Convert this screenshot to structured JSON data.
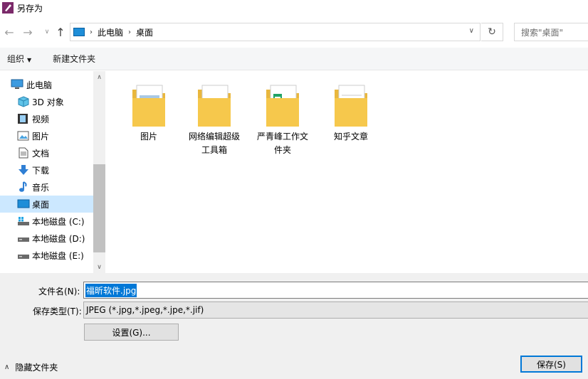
{
  "window": {
    "title": "另存为"
  },
  "nav": {
    "back": "←",
    "forward": "→",
    "recent": "∨",
    "up": "↑",
    "address": [
      "此电脑",
      "桌面"
    ],
    "address_dropdown": "∨",
    "refresh": "↻",
    "search_placeholder": "搜索\"桌面\""
  },
  "toolbar": {
    "organize": "组织",
    "new_folder": "新建文件夹"
  },
  "sidebar": {
    "items": [
      {
        "label": "此电脑",
        "icon": "computer-icon"
      },
      {
        "label": "3D 对象",
        "icon": "3d-objects-icon"
      },
      {
        "label": "视频",
        "icon": "video-icon"
      },
      {
        "label": "图片",
        "icon": "pictures-icon"
      },
      {
        "label": "文档",
        "icon": "documents-icon"
      },
      {
        "label": "下载",
        "icon": "download-icon"
      },
      {
        "label": "音乐",
        "icon": "music-icon"
      },
      {
        "label": "桌面",
        "icon": "desktop-icon",
        "selected": true
      },
      {
        "label": "本地磁盘 (C:)",
        "icon": "windows-drive-icon"
      },
      {
        "label": "本地磁盘 (D:)",
        "icon": "drive-icon"
      },
      {
        "label": "本地磁盘 (E:)",
        "icon": "drive-icon"
      }
    ]
  },
  "folders": [
    {
      "line1": "图片",
      "line2": ""
    },
    {
      "line1": "网络编辑超级",
      "line2": "工具箱"
    },
    {
      "line1": "严青峰工作文",
      "line2": "件夹"
    },
    {
      "line1": "知乎文章",
      "line2": ""
    }
  ],
  "form": {
    "filename_label": "文件名(N):",
    "filename_value": "福昕软件.jpg",
    "filetype_label": "保存类型(T):",
    "filetype_value": "JPEG (*.jpg,*.jpeg,*.jpe,*.jif)",
    "settings_button": "设置(G)...",
    "hide_folders": "隐藏文件夹",
    "save_button": "保存(S)"
  },
  "colors": {
    "accent": "#0078d7",
    "selected_bg": "#cce8ff",
    "folder": "#f6c84c"
  }
}
